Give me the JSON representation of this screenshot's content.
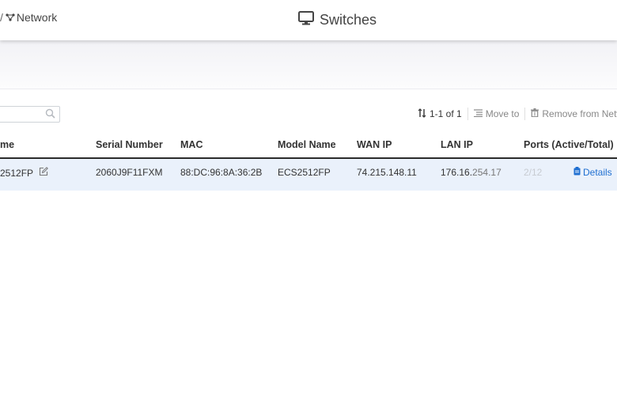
{
  "header": {
    "breadcrumb_sep": "/",
    "breadcrumb_network": "Network",
    "breadcrumb_icon": "network-icon",
    "title": "Switches",
    "title_icon": "monitor-icon"
  },
  "toolbar": {
    "search_placeholder": "",
    "search_icon": "search-icon",
    "sort_icon": "sort-icon",
    "pagination": "1-1 of 1",
    "move_to_label": "Move to",
    "move_to_icon": "list-icon",
    "remove_label": "Remove from Netw",
    "remove_icon": "trash-icon"
  },
  "table": {
    "columns": [
      "me",
      "Serial Number",
      "MAC",
      "Model Name",
      "WAN IP",
      "LAN IP",
      "Ports (Active/Total)"
    ],
    "rows": [
      {
        "name": "2512FP",
        "serial": "2060J9F11FXM",
        "mac": "88:DC:96:8A:36:2B",
        "model": "ECS2512FP",
        "wan_ip": "74.215.148.11",
        "lan_ip_a": "176.16.",
        "lan_ip_b": "254.17",
        "ports": "2/12",
        "details_label": "Details"
      }
    ]
  },
  "colors": {
    "accent": "#1f6fd1",
    "row_selected": "#eaf1fb",
    "header_rule": "#2b2b2b"
  }
}
